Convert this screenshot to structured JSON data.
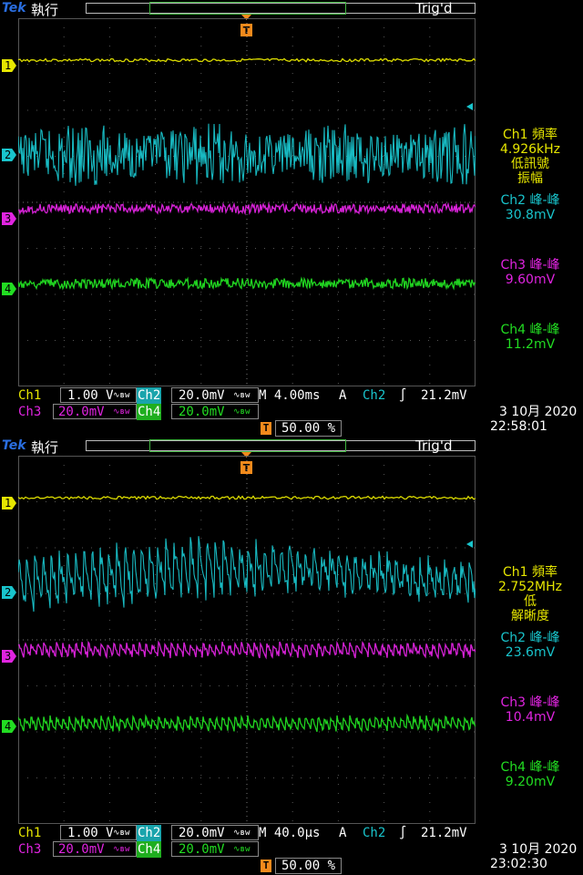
{
  "screens": [
    {
      "brand": "Tek",
      "run_state": "執行",
      "trigger_state": "Trig'd",
      "ch_markers": [
        "1",
        "2",
        "3",
        "4"
      ],
      "measurements": {
        "ch1_line1": "Ch1 頻率",
        "ch1_value": "4.926kHz",
        "ch1_note1": "低訊號",
        "ch1_note2": "振幅",
        "ch2_label": "Ch2 峰-峰",
        "ch2_value": "30.8mV",
        "ch3_label": "Ch3 峰-峰",
        "ch3_value": "9.60mV",
        "ch4_label": "Ch4 峰-峰",
        "ch4_value": "11.2mV"
      },
      "footer": {
        "ch1": "Ch1",
        "ch1_scale": "1.00 V",
        "ch2": "Ch2",
        "ch2_scale": "20.0mV",
        "timebase": "M 4.00ms",
        "acq": "A",
        "trig_src": "Ch2",
        "trig_slope": "∫",
        "trig_level": "21.2mV",
        "ch3": "Ch3",
        "ch3_scale": "20.0mV",
        "ch4": "Ch4",
        "ch4_scale": "20.0mV",
        "trig_pos": "50.00 %",
        "date": "3 10月 2020",
        "time": "22:58:01"
      },
      "traces": {
        "ch1": {
          "level": 0.114,
          "amp": 0.004,
          "period": 0
        },
        "ch2": {
          "level": 0.371,
          "amp": 0.085,
          "period": 0
        },
        "ch3": {
          "level": 0.517,
          "amp": 0.013,
          "period": 0
        },
        "ch4": {
          "level": 0.72,
          "amp": 0.014,
          "period": 0
        }
      }
    },
    {
      "brand": "Tek",
      "run_state": "執行",
      "trigger_state": "Trig'd",
      "ch_markers": [
        "1",
        "2",
        "3",
        "4"
      ],
      "measurements": {
        "ch1_line1": "Ch1 頻率",
        "ch1_value": "2.752MHz",
        "ch1_note1": "低",
        "ch1_note2": "解晰度",
        "ch2_label": "Ch2 峰-峰",
        "ch2_value": "23.6mV",
        "ch3_label": "Ch3 峰-峰",
        "ch3_value": "10.4mV",
        "ch4_label": "Ch4 峰-峰",
        "ch4_value": "9.20mV"
      },
      "footer": {
        "ch1": "Ch1",
        "ch1_scale": "1.00 V",
        "ch2": "Ch2",
        "ch2_scale": "20.0mV",
        "timebase": "M 40.0µs",
        "acq": "A",
        "trig_src": "Ch2",
        "trig_slope": "∫",
        "trig_level": "21.2mV",
        "ch3": "Ch3",
        "ch3_scale": "20.0mV",
        "ch4": "Ch4",
        "ch4_scale": "20.0mV",
        "trig_pos": "50.00 %",
        "date": "3 10月 2020",
        "time": "23:02:30"
      },
      "traces": {
        "ch1": {
          "level": 0.114,
          "amp": 0.004,
          "period": 0
        },
        "ch2": {
          "level": 0.355,
          "amp": 0.07,
          "period": 1
        },
        "ch3": {
          "level": 0.53,
          "amp": 0.02,
          "period": 1
        },
        "ch4": {
          "level": 0.73,
          "amp": 0.02,
          "period": 1
        }
      }
    }
  ],
  "colors": {
    "ch1": "#e6e600",
    "ch2": "#19c4cc",
    "ch3": "#e024e0",
    "ch4": "#22dd22",
    "grid": "#555555",
    "trigger": "#f28a1c"
  }
}
